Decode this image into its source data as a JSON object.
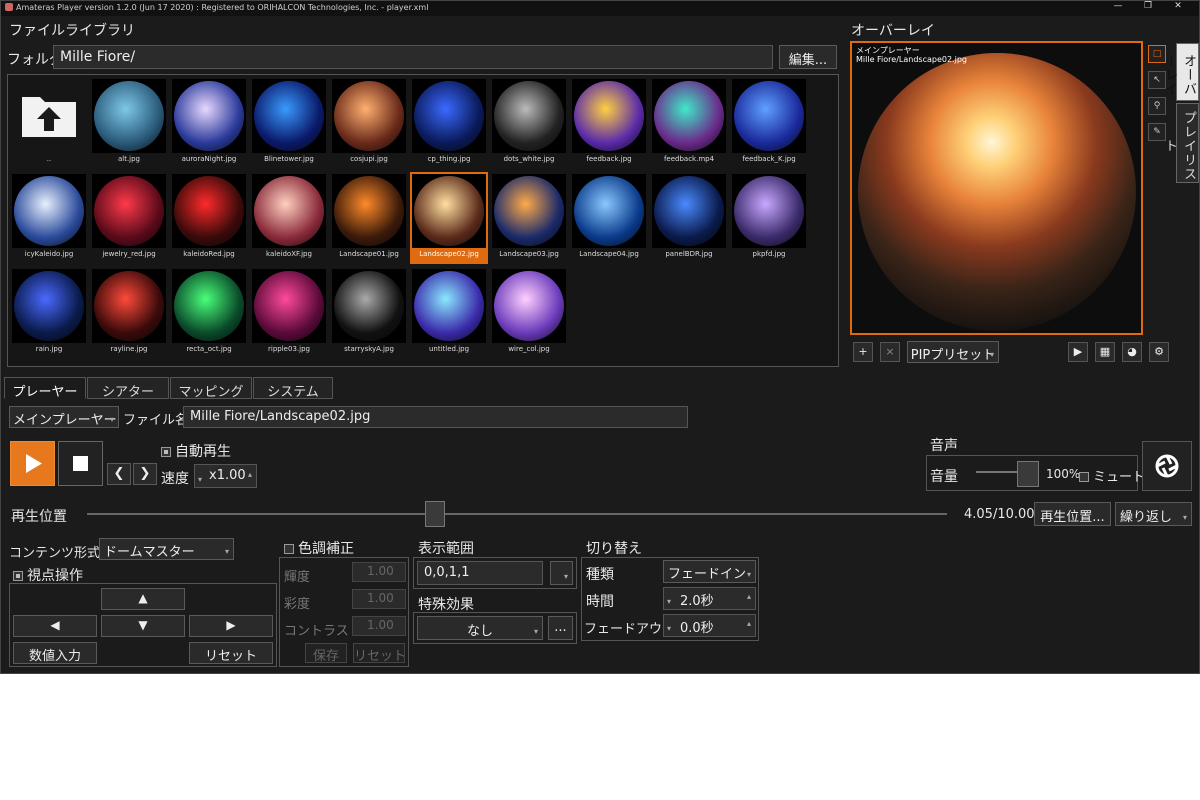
{
  "window": {
    "title": "Amateras Player version 1.2.0 (Jun 17 2020) : Registered to ORIHALCON Technologies, Inc. - player.xml",
    "controls": [
      "—",
      "❐",
      "✕"
    ]
  },
  "library": {
    "title": "ファイルライブラリ",
    "folder_label": "フォルダ",
    "folder_value": "Mille Fiore/",
    "edit_label": "編集...",
    "updir_label": "..",
    "files": [
      {
        "name": "alt.jpg",
        "colors": [
          "#7ec8e8",
          "#2a5a7a"
        ]
      },
      {
        "name": "auroraNight.jpg",
        "colors": [
          "#e8d8ff",
          "#2a3a9a"
        ]
      },
      {
        "name": "Blinetower.jpg",
        "colors": [
          "#3a9aff",
          "#0a1a6a"
        ]
      },
      {
        "name": "cosjupi.jpg",
        "colors": [
          "#ffb070",
          "#6a2a1a"
        ]
      },
      {
        "name": "cp_thing.jpg",
        "colors": [
          "#3a6aff",
          "#0a1a5a"
        ]
      },
      {
        "name": "dots_white.jpg",
        "colors": [
          "#bbbbbb",
          "#222222"
        ]
      },
      {
        "name": "feedback.jpg",
        "colors": [
          "#ffd040",
          "#5a2aaa"
        ]
      },
      {
        "name": "feedback.mp4",
        "colors": [
          "#40e8c8",
          "#6a2a8a"
        ]
      },
      {
        "name": "feedback_K.jpg",
        "colors": [
          "#60a0ff",
          "#1a2a9a"
        ]
      },
      {
        "name": "icyKaleido.jpg",
        "colors": [
          "#e8f0ff",
          "#2a4a9a"
        ]
      },
      {
        "name": "jewelry_red.jpg",
        "colors": [
          "#ff3a4a",
          "#5a0a1a"
        ]
      },
      {
        "name": "kaleidoRed.jpg",
        "colors": [
          "#ff2a2a",
          "#3a0a0a"
        ]
      },
      {
        "name": "kaleidoXF.jpg",
        "colors": [
          "#ffd0c0",
          "#8a2a3a"
        ]
      },
      {
        "name": "Landscape01.jpg",
        "colors": [
          "#ff8a2a",
          "#3a1a0a"
        ]
      },
      {
        "name": "Landscape02.jpg",
        "colors": [
          "#ffe0a0",
          "#5a2a1a"
        ]
      },
      {
        "name": "Landscape03.jpg",
        "colors": [
          "#ffaa4a",
          "#1a2a6a"
        ]
      },
      {
        "name": "Landscape04.jpg",
        "colors": [
          "#8ac8ff",
          "#0a3a8a"
        ]
      },
      {
        "name": "panelBDR.jpg",
        "colors": [
          "#4a8aff",
          "#0a1a4a"
        ]
      },
      {
        "name": "pkpfd.jpg",
        "colors": [
          "#c8a8ff",
          "#3a2a6a"
        ]
      },
      {
        "name": "rain.jpg",
        "colors": [
          "#4a6aff",
          "#0a1a4a"
        ]
      },
      {
        "name": "rayline.jpg",
        "colors": [
          "#ff4a3a",
          "#3a0a0a"
        ]
      },
      {
        "name": "recta_oct.jpg",
        "colors": [
          "#4aff7a",
          "#0a4a2a"
        ]
      },
      {
        "name": "ripple03.jpg",
        "colors": [
          "#ff4a9a",
          "#5a0a3a"
        ]
      },
      {
        "name": "starryskyA.jpg",
        "colors": [
          "#aaaaaa",
          "#111111"
        ]
      },
      {
        "name": "untitled.jpg",
        "colors": [
          "#8ae8ff",
          "#3a2aaa"
        ]
      },
      {
        "name": "wire_col.jpg",
        "colors": [
          "#ffd0ff",
          "#6a3aba"
        ]
      }
    ],
    "selected_index": 14
  },
  "overlay": {
    "title": "オーバーレイ",
    "caption_line1": "メインプレーヤー",
    "caption_line2": "Mille Fiore/Landscape02.jpg",
    "pip_preset": "PIPプリセット",
    "add": "+",
    "remove": "×",
    "side_tabs": [
      "オーバーレイ",
      "プレイリスト"
    ],
    "tools": [
      "□",
      "↖",
      "⚲",
      "✎"
    ],
    "bottom_icons": [
      "▶",
      "▦",
      "◕",
      "⚙"
    ]
  },
  "tabs": [
    "プレーヤー",
    "シアター",
    "マッピング",
    "システム"
  ],
  "player": {
    "player_select": "メインプレーヤー",
    "file_label": "ファイル名",
    "file_value": "Mille Fiore/Landscape02.jpg",
    "autoplay_label": "自動再生",
    "speed_label": "速度",
    "speed_value": "x1.00",
    "prev": "❮",
    "next": "❯",
    "audio_title": "音声",
    "volume_label": "音量",
    "volume_value": "100%",
    "mute_label": "ミュート",
    "volume_level": 1.0,
    "position_label": "再生位置",
    "position_value": "4.05/10.00",
    "position_fraction": 0.405,
    "position_btn": "再生位置...",
    "loop_select": "繰り返し",
    "content_label": "コンテンツ形式",
    "content_value": "ドームマスター",
    "viewpoint_label": "視点操作",
    "num_input": "数値入力",
    "reset": "リセット",
    "color_label": "色調補正",
    "brightness": "輝度",
    "saturation": "彩度",
    "contrast": "コントラスト",
    "brightness_val": "1.00",
    "saturation_val": "1.00",
    "contrast_val": "1.00",
    "save": "保存",
    "color_reset": "リセット",
    "range_label": "表示範囲",
    "range_value": "0,0,1,1",
    "effect_label": "特殊効果",
    "effect_value": "なし",
    "effect_more": "...",
    "switch_label": "切り替え",
    "type_label": "種類",
    "type_value": "フェードイン",
    "time_label": "時間",
    "time_value": "2.0秒",
    "fadeout_label": "フェードアウト",
    "fadeout_value": "0.0秒"
  },
  "colors": {
    "accent": "#e8781e",
    "background": "#1b1b1b"
  }
}
